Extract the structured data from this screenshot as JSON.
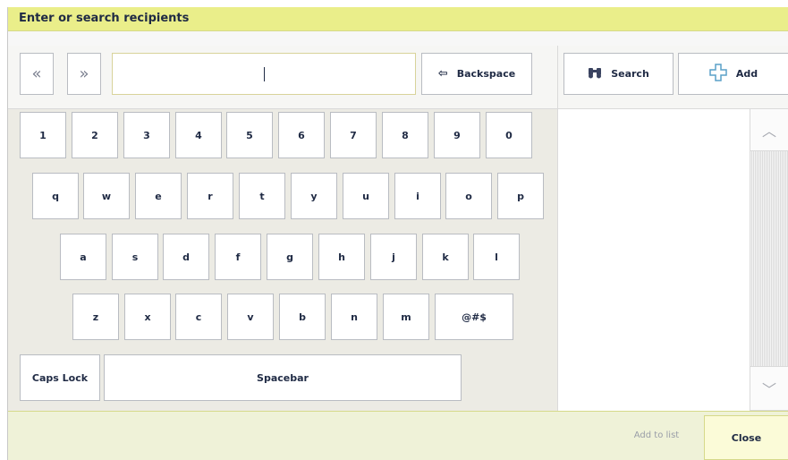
{
  "window": {
    "title": "Enter or search recipients"
  },
  "toolbar": {
    "prev_icon": "«",
    "next_icon": "»",
    "input_value": "",
    "backspace_label": "Backspace",
    "backspace_icon": "⇦",
    "search_label": "Search",
    "search_icon": "binoculars-icon",
    "add_label": "Add",
    "add_icon": "plus-icon"
  },
  "keyboard": {
    "row1": [
      "1",
      "2",
      "3",
      "4",
      "5",
      "6",
      "7",
      "8",
      "9",
      "0"
    ],
    "row2": [
      "q",
      "w",
      "e",
      "r",
      "t",
      "y",
      "u",
      "i",
      "o",
      "p"
    ],
    "row3": [
      "a",
      "s",
      "d",
      "f",
      "g",
      "h",
      "j",
      "k",
      "l"
    ],
    "row4": [
      "z",
      "x",
      "c",
      "v",
      "b",
      "n",
      "m",
      "@#$"
    ],
    "caps_label": "Caps Lock",
    "space_label": "Spacebar"
  },
  "scroll": {
    "up_icon": "︿",
    "down_icon": "﹀"
  },
  "footer": {
    "add_to_list_label": "Add to list",
    "close_label": "Close"
  },
  "colors": {
    "title_bar": "#eaee8a",
    "footer": "#eff2d8",
    "keyboard_bg": "#ecebe4"
  }
}
